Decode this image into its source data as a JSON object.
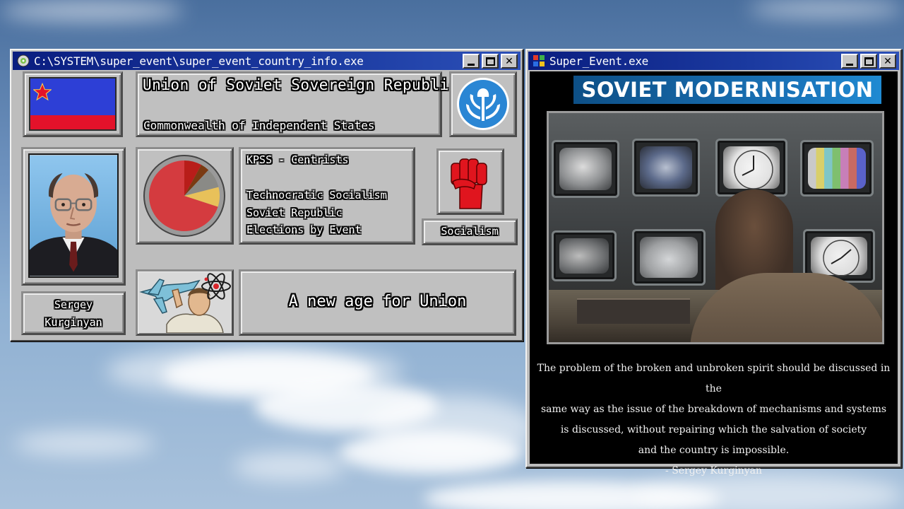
{
  "country_window": {
    "title": "C:\\SYSTEM\\super_event\\super_event_country_info.exe",
    "country_name": "Union of Soviet Sovereign Republics",
    "faction": "Commonwealth of Independent States",
    "leader": {
      "first_name": "Sergey",
      "last_name": "Kurginyan"
    },
    "party_info": {
      "party": "KPSS - Centrists",
      "ideology": "Technocratic Socialism",
      "government": "Soviet Republic",
      "elections": "Elections by Event"
    },
    "ideology_label": "Socialism",
    "slogan": "A new age for Union",
    "popularity_chart": {
      "type": "pie",
      "slices": [
        {
          "value": 0.7,
          "color": "#d43b3f"
        },
        {
          "value": 0.08,
          "color": "#b81d19"
        },
        {
          "value": 0.04,
          "color": "#7a3a12"
        },
        {
          "value": 0.09,
          "color": "#8a8a86"
        },
        {
          "value": 0.09,
          "color": "#e8c15a"
        }
      ]
    },
    "colors": {
      "flag_top": "#2d3fd6",
      "flag_bottom": "#e3122a",
      "cis_blue": "#2a86d4"
    }
  },
  "event_window": {
    "title": "Super_Event.exe",
    "banner": "SOVIET MODERNISATION",
    "quote_lines": [
      "The problem of the broken and unbroken spirit should be discussed in the",
      "same way as the issue of the breakdown of mechanisms and systems",
      "is discussed, without repairing which the salvation of society",
      "and the country is impossible.",
      "- Sergey Kurginyan"
    ]
  }
}
